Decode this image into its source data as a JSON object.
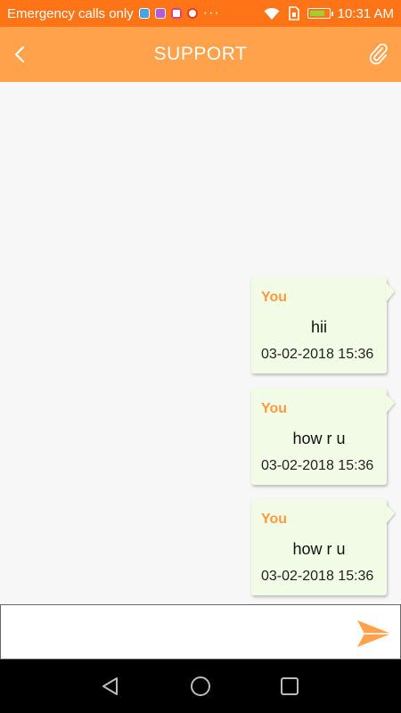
{
  "status_bar": {
    "carrier": "Emergency calls only",
    "notification_icons": [
      "app-icon",
      "gallery-icon",
      "instagram-icon",
      "google-icon"
    ],
    "overflow": "···",
    "system_icons": [
      "wifi-icon",
      "sim-icon",
      "battery-icon"
    ],
    "time": "10:31 AM",
    "color": "#ff7417"
  },
  "header": {
    "title": "SUPPORT",
    "back_icon": "chevron-left-icon",
    "attach_icon": "paperclip-icon",
    "color": "#ffa24b"
  },
  "messages": [
    {
      "sender": "You",
      "text": "hii",
      "time": "03-02-2018 15:36"
    },
    {
      "sender": "You",
      "text": "how r u",
      "time": "03-02-2018 15:36"
    },
    {
      "sender": "You",
      "text": "how r u",
      "time": "03-02-2018 15:36"
    }
  ],
  "composer": {
    "value": "",
    "placeholder": "",
    "send_icon": "send-icon",
    "accent": "#ffa24b"
  },
  "nav_bar": {
    "buttons": [
      "back-triangle-icon",
      "home-circle-icon",
      "recents-square-icon"
    ]
  }
}
